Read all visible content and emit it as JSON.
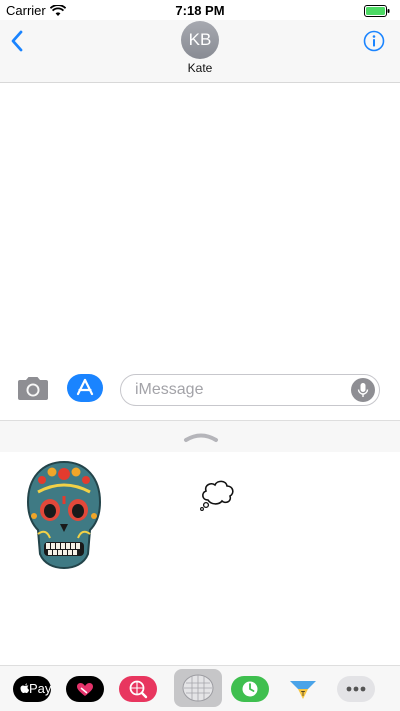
{
  "status_bar": {
    "carrier": "Carrier",
    "time": "7:18 PM"
  },
  "header": {
    "avatar_initials": "KB",
    "contact_name": "Kate"
  },
  "compose": {
    "placeholder": "iMessage"
  },
  "app_strip": {
    "apple_pay_label": "Pay"
  },
  "colors": {
    "accent": "#1a84ff",
    "battery": "#4cd964",
    "header_bg": "#f7f7f7"
  },
  "icons": [
    "back-chevron-icon",
    "info-icon",
    "camera-icon",
    "app-store-icon",
    "mic-icon",
    "drawer-handle-icon",
    "skull-sticker",
    "thought-bubble-sticker"
  ]
}
